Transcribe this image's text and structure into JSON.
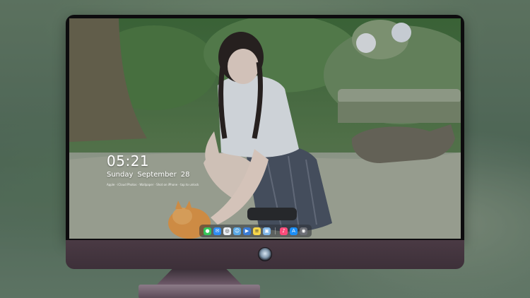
{
  "lock_screen": {
    "time": "05:21",
    "weekday": "Sunday",
    "month": "September",
    "day": "28",
    "fine_print": "Apple · iCloud Photos · Wallpaper · Shot on iPhone · tap to unlock"
  },
  "dock": {
    "items": [
      {
        "name": "messages",
        "icon": "message-bubble-icon",
        "color": "#35c759",
        "glyph": "●"
      },
      {
        "name": "mail",
        "icon": "mail-icon",
        "color": "#2f8cf2",
        "glyph": "✉"
      },
      {
        "name": "safari",
        "icon": "compass-icon",
        "color": "#e9eef4",
        "glyph": "◎"
      },
      {
        "name": "finder",
        "icon": "finder-icon",
        "color": "#5aa9e6",
        "glyph": "☺"
      },
      {
        "name": "video",
        "icon": "clapper-icon",
        "color": "#3a7bd5",
        "glyph": "▶"
      },
      {
        "name": "notes",
        "icon": "notes-icon",
        "color": "#f6d64a",
        "glyph": "≡"
      },
      {
        "name": "preview",
        "icon": "photo-icon",
        "color": "#7fb6e8",
        "glyph": "▣"
      },
      {
        "name": "music",
        "icon": "music-note-icon",
        "color": "#fa4c7a",
        "glyph": "♪"
      },
      {
        "name": "app-store",
        "icon": "app-store-icon",
        "color": "#1c8ef4",
        "glyph": "A"
      },
      {
        "name": "camera",
        "icon": "camera-icon",
        "color": "#6d6f76",
        "glyph": "◉"
      }
    ]
  },
  "colors": {
    "bezel": "#0d0c0e",
    "chin": "#4a3a44",
    "stand": "#6e5a69"
  }
}
